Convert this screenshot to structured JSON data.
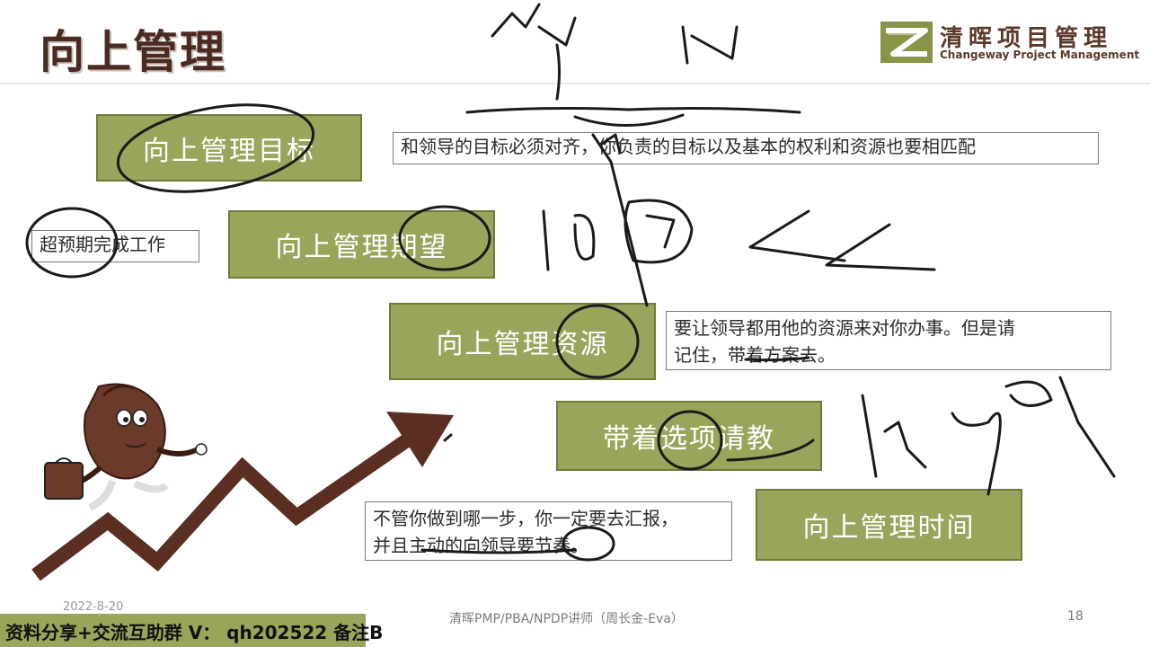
{
  "slide": {
    "title": "向上管理",
    "logo": {
      "name_cn": "清晖项目管理",
      "name_en": "Changeway Project Management"
    },
    "boxes": {
      "goal": "向上管理目标",
      "expectation": "向上管理期望",
      "resources": "向上管理资源",
      "options": "带着选项请教",
      "time": "向上管理时间"
    },
    "notes": {
      "goal": "和领导的目标必须对齐，你负责的目标以及基本的权利和资源也要相匹配",
      "expectation": "超预期完成工作",
      "resources_line1": "要让领导都用他的资源来对你办事。但是请",
      "resources_line2": "记住，带着方案去。",
      "time_line1": "不管你做到哪一步，你一定要去汇报，",
      "time_line2": "并且主动的向领导要节奏。"
    },
    "footer": {
      "date": "2022-8-20",
      "banner": "资料分享+交流互助群 V： qh202522 备注B",
      "center": "清晖PMP/PBA/NPDP讲师（周长金-Eva）",
      "page": "18"
    }
  },
  "colors": {
    "olive": "#9aa55b",
    "brown": "#5b2e22",
    "ink": "#1a1a1a"
  }
}
